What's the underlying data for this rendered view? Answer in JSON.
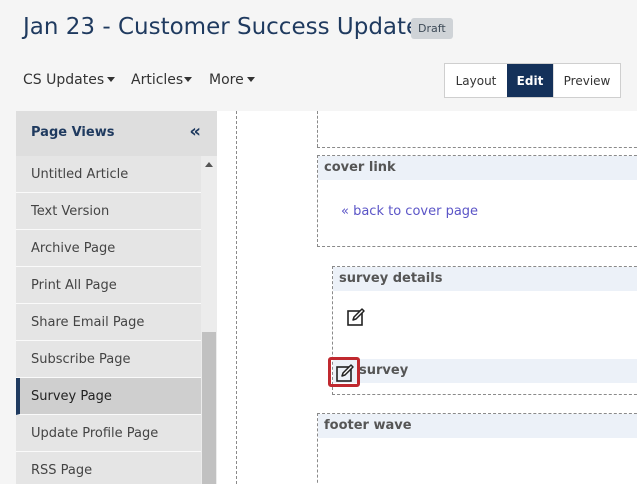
{
  "header": {
    "title": "Jan 23 - Customer Success Updates",
    "badge": "Draft"
  },
  "nav": {
    "cs_updates": "CS Updates",
    "articles": "Articles",
    "more": "More"
  },
  "view_toggle": {
    "layout": "Layout",
    "edit": "Edit",
    "preview": "Preview",
    "active": "Edit"
  },
  "sidebar": {
    "title": "Page Views",
    "collapse_icon": "double-chevron-left-icon",
    "items": [
      {
        "label": "Untitled Article"
      },
      {
        "label": "Text Version"
      },
      {
        "label": "Archive Page"
      },
      {
        "label": "Print All Page"
      },
      {
        "label": "Share Email Page"
      },
      {
        "label": "Subscribe Page"
      },
      {
        "label": "Survey Page",
        "active": true
      },
      {
        "label": "Update Profile Page"
      },
      {
        "label": "RSS Page"
      }
    ]
  },
  "canvas": {
    "cover_link_label": "cover link",
    "back_link": "« back to cover page",
    "survey_details_label": "survey details",
    "survey_label": "survey",
    "footer_wave_label": "footer wave",
    "edit_icon": "edit-pencil-icon"
  },
  "colors": {
    "accent": "#14315a",
    "title": "#1f3a5f",
    "link": "#5b55c7",
    "highlight": "#c0292f",
    "label_bg": "#ecf1f8"
  }
}
